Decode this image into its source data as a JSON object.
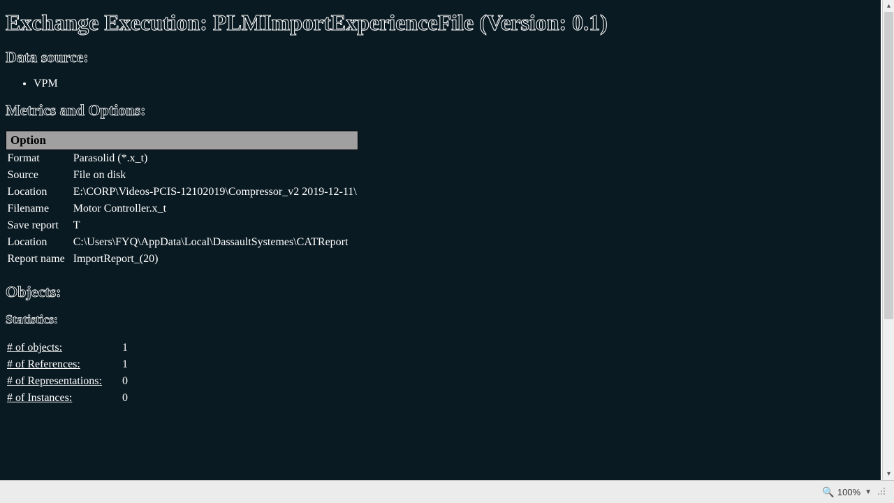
{
  "title": "Exchange Execution: PLMImportExperienceFile (Version: 0.1)",
  "data_source_heading": "Data source:",
  "data_source_items": [
    "VPM"
  ],
  "metrics_heading": "Metrics and Options:",
  "option_header": "Option",
  "options": [
    {
      "key": "Format",
      "value": "Parasolid (*.x_t)"
    },
    {
      "key": "Source",
      "value": "File on disk"
    },
    {
      "key": "Location",
      "value": "E:\\CORP\\Videos-PCIS-12102019\\Compressor_v2 2019-12-11\\"
    },
    {
      "key": "Filename",
      "value": "Motor Controller.x_t"
    },
    {
      "key": "Save report",
      "value": "T"
    },
    {
      "key": "Location",
      "value": "C:\\Users\\FYQ\\AppData\\Local\\DassaultSystemes\\CATReport"
    },
    {
      "key": "Report name",
      "value": "ImportReport_(20)"
    }
  ],
  "objects_heading": "Objects:",
  "statistics_heading": "Statistics:",
  "stats": [
    {
      "label": "# of objects:",
      "value": "1"
    },
    {
      "label": "# of References:",
      "value": "1"
    },
    {
      "label": "# of Representations:",
      "value": "0"
    },
    {
      "label": "# of Instances:",
      "value": "0"
    }
  ],
  "status": {
    "zoom": "100%"
  }
}
